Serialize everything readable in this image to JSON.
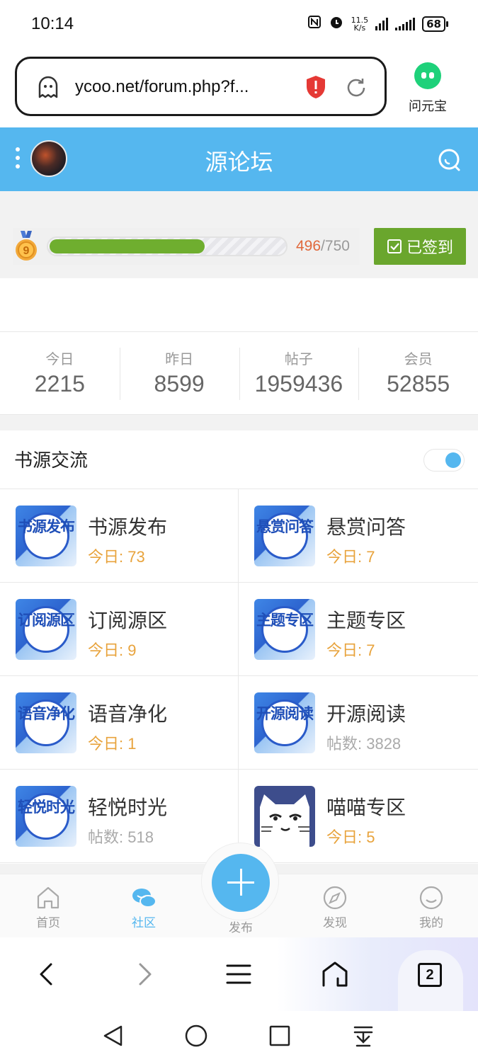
{
  "status_bar": {
    "time": "10:14",
    "net_speed_value": "11.5",
    "net_speed_unit": "K/s",
    "battery": "68"
  },
  "browser": {
    "url": "ycoo.net/forum.php?f...",
    "assistant_label": "问元宝",
    "tabs_count": "2"
  },
  "header": {
    "title": "源论坛"
  },
  "level": {
    "badge_number": "9",
    "current": "496",
    "separator": "/",
    "max": "750",
    "progress_fraction": 0.661,
    "sign_button": "已签到"
  },
  "stats": [
    {
      "label": "今日",
      "value": "2215"
    },
    {
      "label": "昨日",
      "value": "8599"
    },
    {
      "label": "帖子",
      "value": "1959436"
    },
    {
      "label": "会员",
      "value": "52855"
    }
  ],
  "section": {
    "title": "书源交流",
    "toggle_on": true
  },
  "forums": [
    {
      "name": "书源发布",
      "icon_text": "书源发布",
      "stat": "今日: 73",
      "stat_type": "today"
    },
    {
      "name": "悬赏问答",
      "icon_text": "悬赏问答",
      "stat": "今日: 7",
      "stat_type": "today"
    },
    {
      "name": "订阅源区",
      "icon_text": "订阅源区",
      "stat": "今日: 9",
      "stat_type": "today"
    },
    {
      "name": "主题专区",
      "icon_text": "主题专区",
      "stat": "今日: 7",
      "stat_type": "today"
    },
    {
      "name": "语音净化",
      "icon_text": "语音净化",
      "stat": "今日: 1",
      "stat_type": "today"
    },
    {
      "name": "开源阅读",
      "icon_text": "开源阅读",
      "stat": "帖数: 3828",
      "stat_type": "posts"
    },
    {
      "name": "轻悦时光",
      "icon_text": "轻悦时光",
      "stat": "帖数: 518",
      "stat_type": "posts"
    },
    {
      "name": "喵喵专区",
      "icon_text": "",
      "stat": "今日: 5",
      "stat_type": "today"
    }
  ],
  "app_nav": {
    "home": "首页",
    "community": "社区",
    "publish": "发布",
    "discover": "发现",
    "mine": "我的"
  },
  "colors": {
    "accent": "#55b7ef",
    "sign_green": "#6aa62d",
    "progress_green": "#6fae2f",
    "today_orange": "#e8a33c"
  }
}
